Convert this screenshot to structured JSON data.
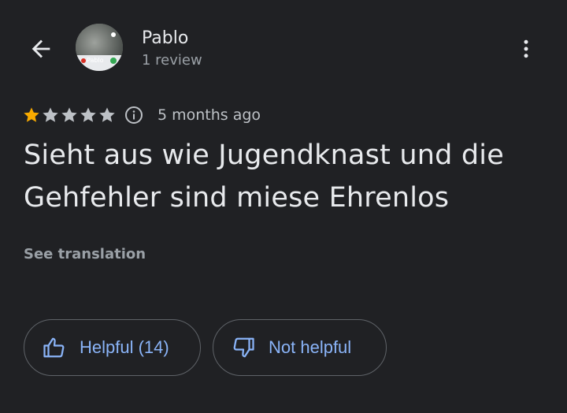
{
  "colors": {
    "background": "#202124",
    "primary_text": "#e8eaed",
    "secondary_text": "#9aa0a6",
    "accent_blue": "#8ab4f8",
    "star_filled": "#f9ab00",
    "star_empty": "#bdc1c6",
    "outline": "#5f6368"
  },
  "header": {
    "back_icon": "arrow-left-icon",
    "author": {
      "name": "Pablo",
      "review_count": "1 review",
      "avatar_label": "Pablo"
    },
    "more_icon": "more-vertical-icon"
  },
  "review": {
    "rating": 1,
    "rating_max": 5,
    "info_icon": "info-icon",
    "date": "5 months ago",
    "text": "Sieht aus wie Jugendknast und die Gehfehler sind miese Ehrenlos",
    "see_translation": "See translation"
  },
  "actions": {
    "helpful": {
      "label": "Helpful (14)",
      "icon": "thumbs-up-icon"
    },
    "not_helpful": {
      "label": "Not helpful",
      "icon": "thumbs-down-icon"
    }
  }
}
